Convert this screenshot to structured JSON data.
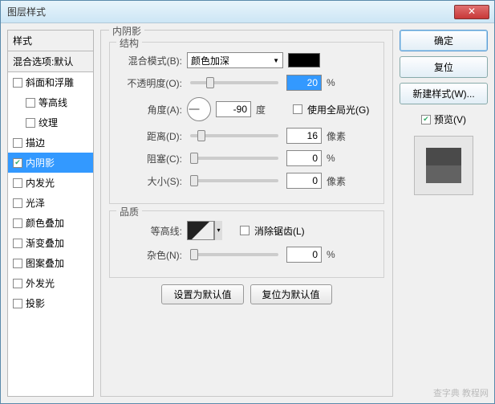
{
  "window": {
    "title": "图层样式"
  },
  "left": {
    "header": "样式",
    "subheader": "混合选项:默认",
    "items": [
      {
        "label": "斜面和浮雕",
        "checked": false,
        "indent": false
      },
      {
        "label": "等高线",
        "checked": false,
        "indent": true
      },
      {
        "label": "纹理",
        "checked": false,
        "indent": true
      },
      {
        "label": "描边",
        "checked": false,
        "indent": false
      },
      {
        "label": "内阴影",
        "checked": true,
        "indent": false,
        "selected": true
      },
      {
        "label": "内发光",
        "checked": false,
        "indent": false
      },
      {
        "label": "光泽",
        "checked": false,
        "indent": false
      },
      {
        "label": "颜色叠加",
        "checked": false,
        "indent": false
      },
      {
        "label": "渐变叠加",
        "checked": false,
        "indent": false
      },
      {
        "label": "图案叠加",
        "checked": false,
        "indent": false
      },
      {
        "label": "外发光",
        "checked": false,
        "indent": false
      },
      {
        "label": "投影",
        "checked": false,
        "indent": false
      }
    ]
  },
  "panel": {
    "title": "内阴影",
    "structure": {
      "legend": "结构",
      "blend_label": "混合模式(B):",
      "blend_value": "颜色加深",
      "opacity_label": "不透明度(O):",
      "opacity_value": "20",
      "opacity_unit": "%",
      "angle_label": "角度(A):",
      "angle_value": "-90",
      "angle_unit": "度",
      "global_light_label": "使用全局光(G)",
      "distance_label": "距离(D):",
      "distance_value": "16",
      "distance_unit": "像素",
      "choke_label": "阻塞(C):",
      "choke_value": "0",
      "choke_unit": "%",
      "size_label": "大小(S):",
      "size_value": "0",
      "size_unit": "像素"
    },
    "quality": {
      "legend": "品质",
      "contour_label": "等高线:",
      "antialias_label": "消除锯齿(L)",
      "noise_label": "杂色(N):",
      "noise_value": "0",
      "noise_unit": "%"
    },
    "buttons": {
      "default": "设置为默认值",
      "reset": "复位为默认值"
    }
  },
  "right": {
    "ok": "确定",
    "reset": "复位",
    "new_style": "新建样式(W)...",
    "preview_label": "预览(V)"
  },
  "watermark": "查字典 教程网"
}
